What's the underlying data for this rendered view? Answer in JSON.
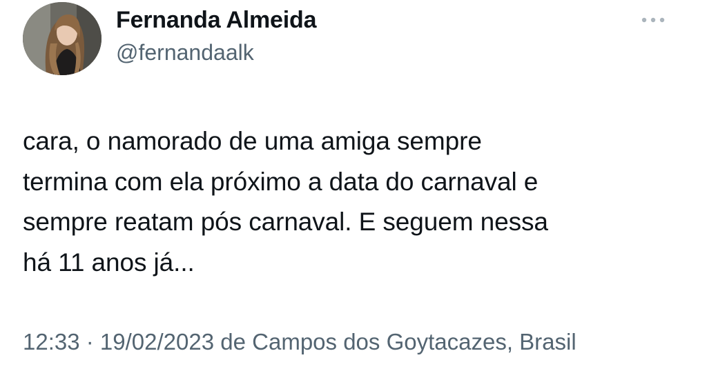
{
  "tweet": {
    "author": {
      "display_name": "Fernanda Almeida",
      "handle": "@fernandaalk",
      "avatar_icon": "profile-photo"
    },
    "more_icon": "more-horizontal-icon",
    "text": "cara, o namorado de uma amiga sempre\ntermina com ela próximo a data do carnaval e\nsempre reatam pós carnaval. E seguem nessa\nhá 11 anos já...",
    "time": "12:33",
    "separator": " · ",
    "date": "19/02/2023",
    "location_prefix": " de ",
    "location": "Campos dos Goytacazes, Brasil"
  },
  "colors": {
    "text": "#0f1419",
    "secondary": "#536471",
    "background": "#ffffff"
  }
}
